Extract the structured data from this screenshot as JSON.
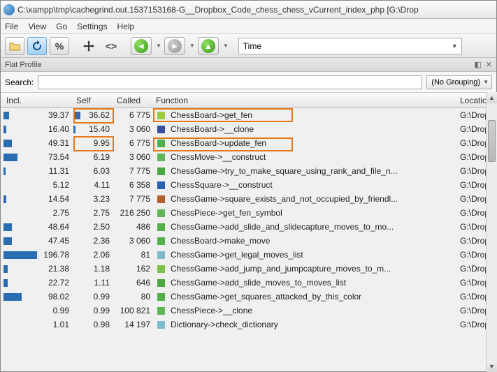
{
  "titlebar": {
    "title": "C:\\xampp\\tmp\\cachegrind.out.1537153168-G__Dropbox_Code_chess_chess_vCurrent_index_php [G:\\Drop"
  },
  "menu": {
    "items": [
      "File",
      "View",
      "Go",
      "Settings",
      "Help"
    ]
  },
  "toolbar": {
    "time_label": "Time"
  },
  "panel": {
    "title": "Flat Profile"
  },
  "search": {
    "label": "Search:",
    "grouping": "(No Grouping)"
  },
  "table": {
    "headers": {
      "incl": "Incl.",
      "self": "Self",
      "called": "Called",
      "func": "Function",
      "loc": "Locatio"
    },
    "loc_value": "G:\\Drop",
    "rows": [
      {
        "incl": "39.37",
        "incl_w": 8,
        "self": "36.62",
        "self_w": 10,
        "called": "6 775",
        "swatch": "#9ccb3b",
        "func": "ChessBoard->get_fen"
      },
      {
        "incl": "16.40",
        "incl_w": 4,
        "self": "15.40",
        "self_w": 3,
        "called": "3 060",
        "swatch": "#3a4ea0",
        "func": "ChessBoard->__clone"
      },
      {
        "incl": "49.31",
        "incl_w": 12,
        "self": "9.95",
        "self_w": 2,
        "called": "6 775",
        "swatch": "#52b04a",
        "func": "ChessBoard->update_fen"
      },
      {
        "incl": "73.54",
        "incl_w": 20,
        "self": "6.19",
        "self_w": 0,
        "called": "3 060",
        "swatch": "#5fb658",
        "func": "ChessMove->__construct"
      },
      {
        "incl": "11.31",
        "incl_w": 3,
        "self": "6.03",
        "self_w": 0,
        "called": "7 775",
        "swatch": "#4aa842",
        "func": "ChessGame->try_to_make_square_using_rank_and_file_n..."
      },
      {
        "incl": "5.12",
        "incl_w": 0,
        "self": "4.11",
        "self_w": 0,
        "called": "6 358",
        "swatch": "#2b5fb0",
        "func": "ChessSquare->__construct"
      },
      {
        "incl": "14.54",
        "incl_w": 4,
        "self": "3.23",
        "self_w": 0,
        "called": "7 775",
        "swatch": "#b0602a",
        "func": "ChessGame->square_exists_and_not_occupied_by_friendl..."
      },
      {
        "incl": "2.75",
        "incl_w": 0,
        "self": "2.75",
        "self_w": 0,
        "called": "216 250",
        "swatch": "#5fb658",
        "func": "ChessPiece->get_fen_symbol"
      },
      {
        "incl": "48.64",
        "incl_w": 12,
        "self": "2.50",
        "self_w": 0,
        "called": "486",
        "swatch": "#52b04a",
        "func": "ChessGame->add_slide_and_slidecapture_moves_to_mo..."
      },
      {
        "incl": "47.45",
        "incl_w": 12,
        "self": "2.36",
        "self_w": 0,
        "called": "3 060",
        "swatch": "#52b04a",
        "func": "ChessBoard->make_move"
      },
      {
        "incl": "196.78",
        "incl_w": 48,
        "self": "2.06",
        "self_w": 0,
        "called": "81",
        "swatch": "#7fbacc",
        "func": "ChessGame->get_legal_moves_list"
      },
      {
        "incl": "21.38",
        "incl_w": 6,
        "self": "1.18",
        "self_w": 0,
        "called": "162",
        "swatch": "#7ec24a",
        "func": "ChessGame->add_jump_and_jumpcapture_moves_to_m..."
      },
      {
        "incl": "22.72",
        "incl_w": 6,
        "self": "1.11",
        "self_w": 0,
        "called": "646",
        "swatch": "#4aa842",
        "func": "ChessGame->add_slide_moves_to_moves_list"
      },
      {
        "incl": "98.02",
        "incl_w": 26,
        "self": "0.99",
        "self_w": 0,
        "called": "80",
        "swatch": "#52b04a",
        "func": "ChessGame->get_squares_attacked_by_this_color"
      },
      {
        "incl": "0.99",
        "incl_w": 0,
        "self": "0.99",
        "self_w": 0,
        "called": "100 821",
        "swatch": "#5fb658",
        "func": "ChessPiece->__clone"
      },
      {
        "incl": "1.01",
        "incl_w": 0,
        "self": "0.98",
        "self_w": 0,
        "called": "14 197",
        "swatch": "#7fbacc",
        "func": "Dictionary->check_dictionary"
      }
    ]
  }
}
